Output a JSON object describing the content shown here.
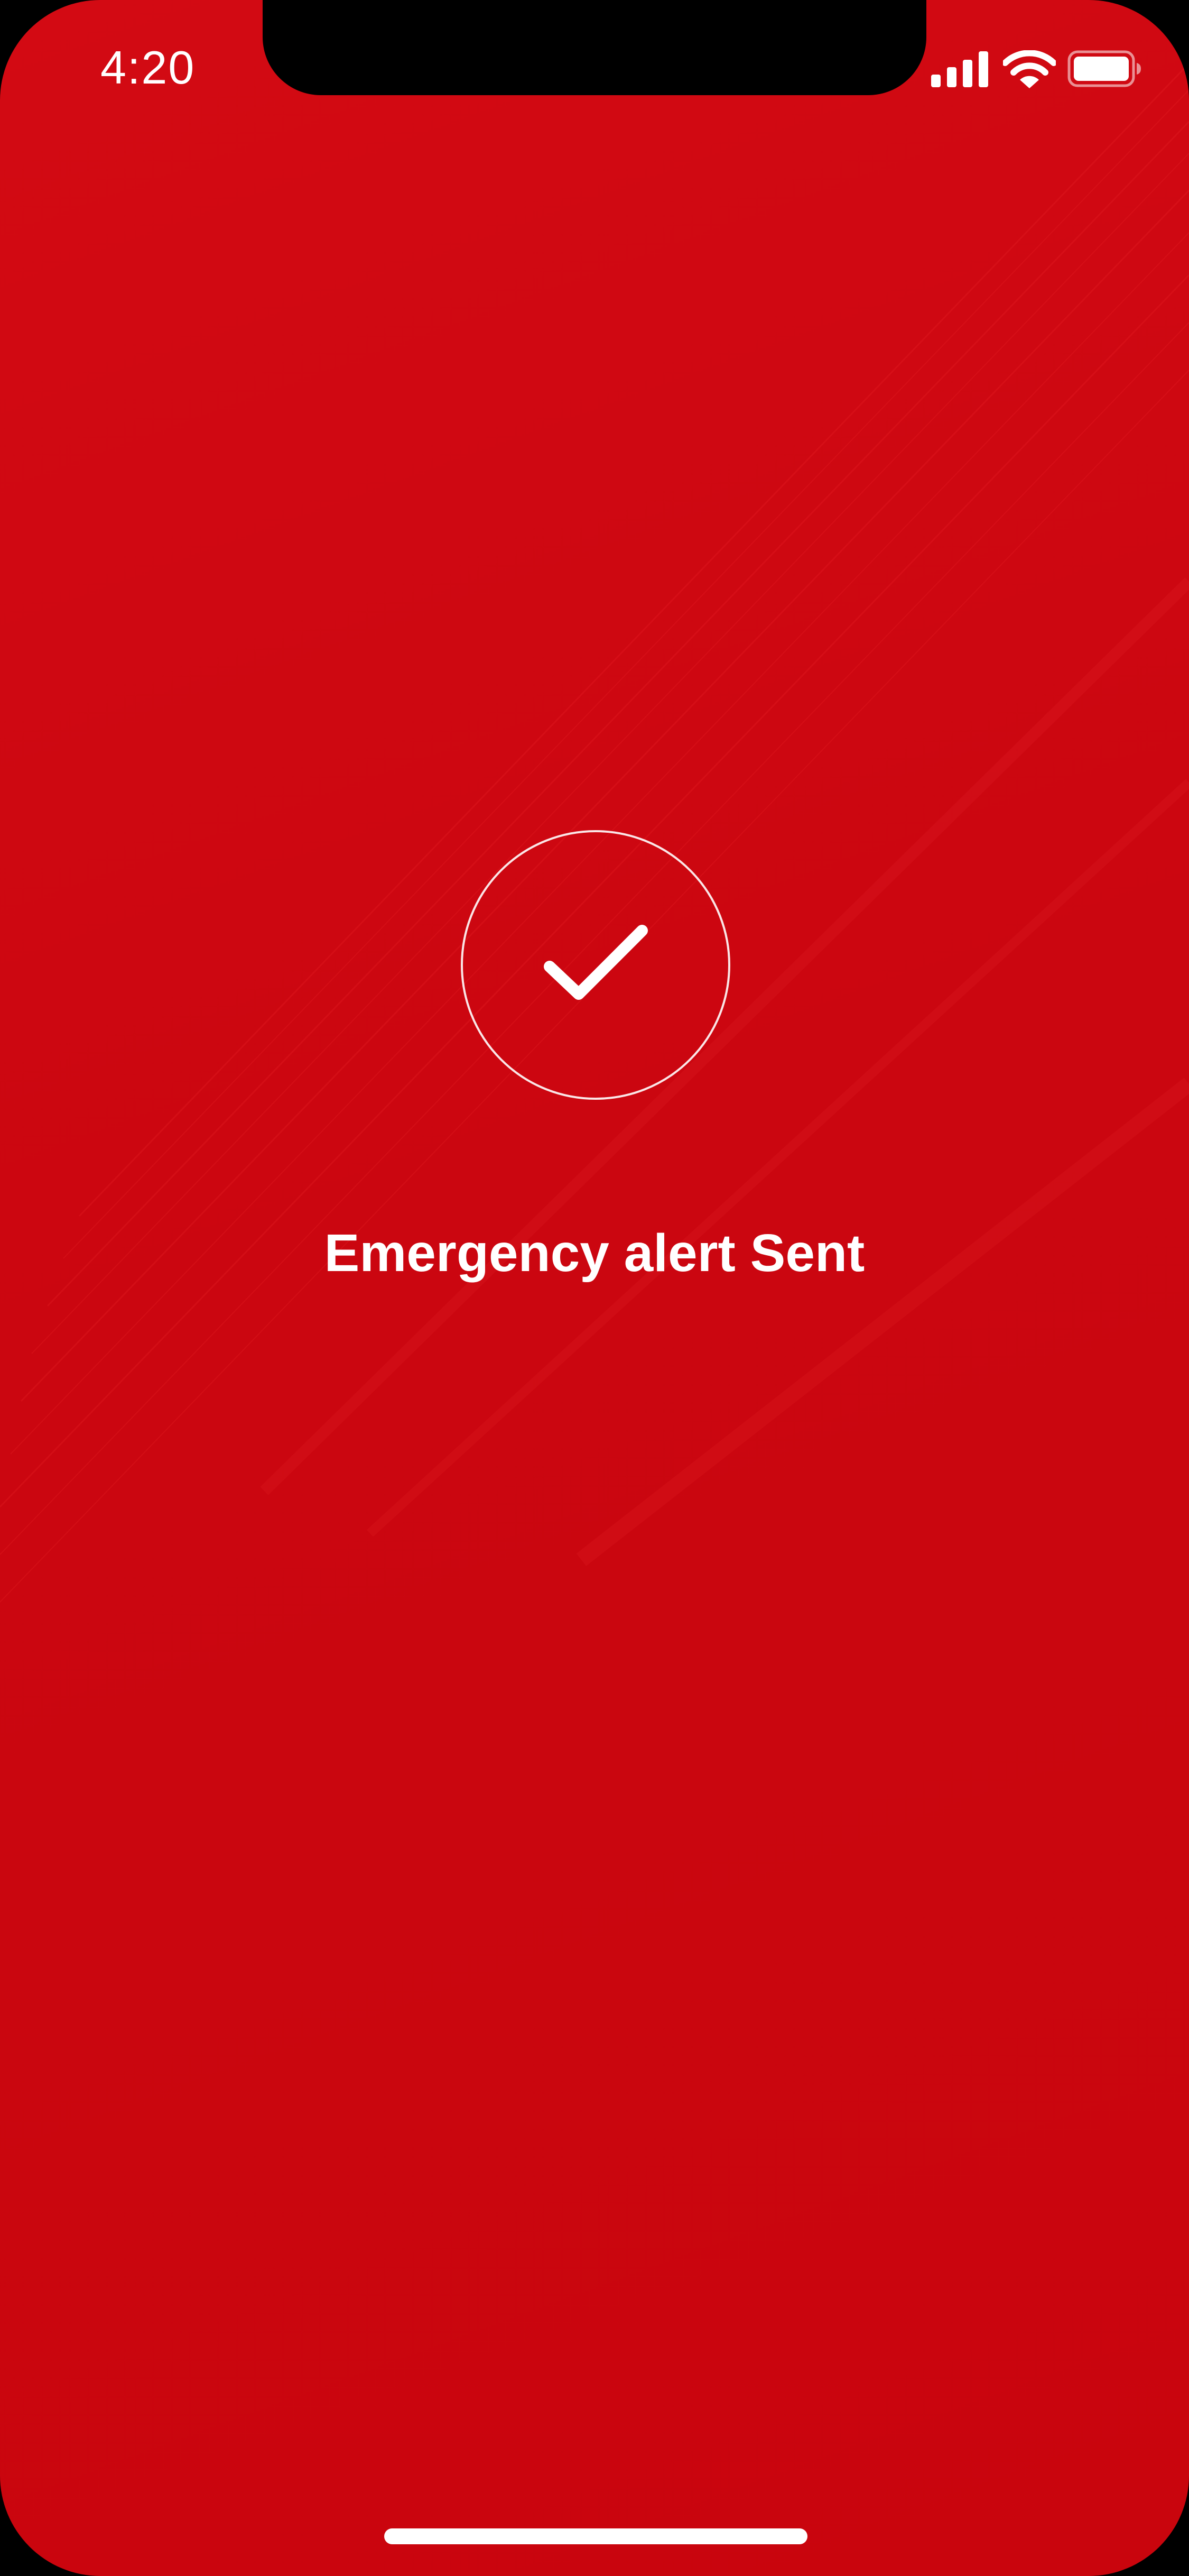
{
  "status_bar": {
    "time": "4:20",
    "icons": [
      "cellular-signal-icon",
      "wifi-icon",
      "battery-icon"
    ]
  },
  "alert": {
    "icon": "checkmark-icon",
    "message": "Emergency alert Sent"
  },
  "colors": {
    "background": "#cb0610",
    "foreground": "#ffffff"
  }
}
